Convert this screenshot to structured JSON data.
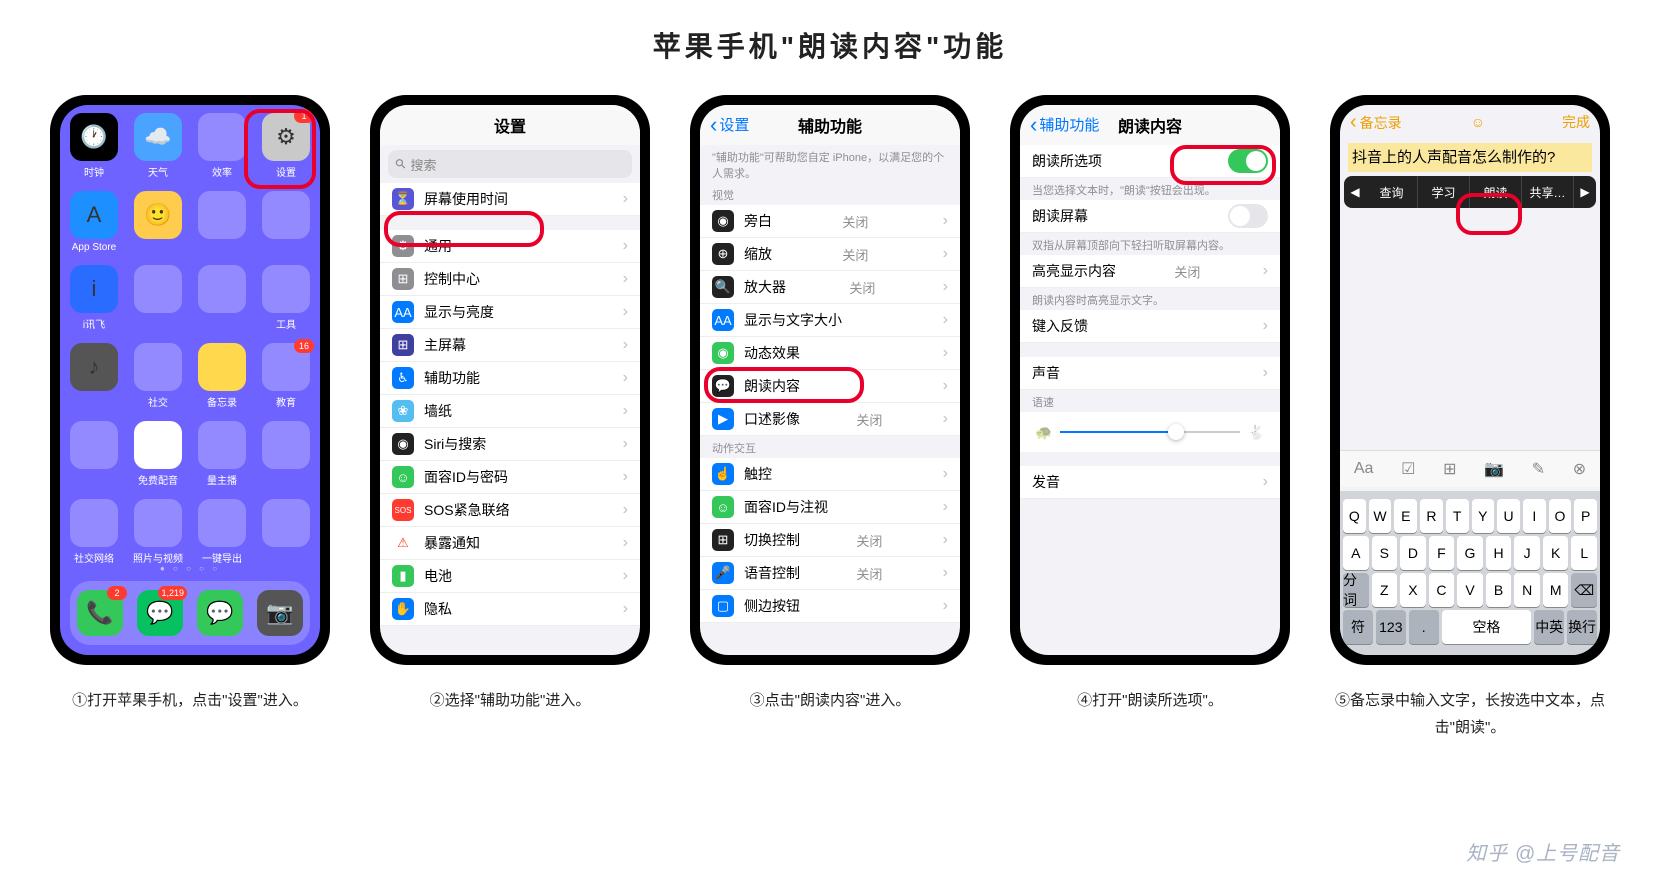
{
  "title": "苹果手机\"朗读内容\"功能",
  "watermark": "知乎 @上号配音",
  "steps": [
    {
      "caption": "①打开苹果手机，点击\"设置\"进入。"
    },
    {
      "caption": "②选择\"辅助功能\"进入。"
    },
    {
      "caption": "③点击\"朗读内容\"进入。"
    },
    {
      "caption": "④打开\"朗读所选项\"。"
    },
    {
      "caption": "⑤备忘录中输入文字，长按选中文本，点击\"朗读\"。"
    }
  ],
  "p1": {
    "apps": [
      {
        "lbl": "时钟",
        "g": "🕐",
        "bg": "#000"
      },
      {
        "lbl": "天气",
        "g": "☁️",
        "bg": "#4aa3ff"
      },
      {
        "lbl": "效率",
        "g": "",
        "bg": ""
      },
      {
        "lbl": "设置",
        "g": "⚙︎",
        "bg": "#c9c9c9",
        "badge": "1"
      },
      {
        "lbl": "App Store",
        "g": "A",
        "bg": "#1e8fff"
      },
      {
        "lbl": "",
        "g": "🙂",
        "bg": "#ffcc4d"
      },
      {
        "lbl": "",
        "g": "",
        "bg": ""
      },
      {
        "lbl": "",
        "g": "",
        "bg": ""
      },
      {
        "lbl": "i讯飞",
        "g": "i",
        "bg": "#2a6cff"
      },
      {
        "lbl": "",
        "g": "",
        "bg": ""
      },
      {
        "lbl": "",
        "g": "",
        "bg": ""
      },
      {
        "lbl": "工具",
        "g": "",
        "bg": ""
      },
      {
        "lbl": "",
        "g": "♪",
        "bg": "#555"
      },
      {
        "lbl": "社交",
        "g": "",
        "bg": ""
      },
      {
        "lbl": "备忘录",
        "g": "",
        "bg": "#ffd84d"
      },
      {
        "lbl": "教育",
        "g": "",
        "bg": "",
        "badge": "16"
      },
      {
        "lbl": "",
        "g": "",
        "bg": ""
      },
      {
        "lbl": "免费配音",
        "g": "",
        "bg": "#fff"
      },
      {
        "lbl": "量主播",
        "g": "",
        "bg": ""
      },
      {
        "lbl": "",
        "g": "",
        "bg": ""
      },
      {
        "lbl": "社交网络",
        "g": "",
        "bg": ""
      },
      {
        "lbl": "照片与视频",
        "g": "",
        "bg": ""
      },
      {
        "lbl": "一键导出",
        "g": "",
        "bg": ""
      },
      {
        "lbl": "",
        "g": "",
        "bg": ""
      }
    ],
    "dock": [
      {
        "g": "📞",
        "bg": "#34c759",
        "badge": "2"
      },
      {
        "g": "💬",
        "bg": "#07c160",
        "badge": "1,219"
      },
      {
        "g": "💬",
        "bg": "#34c759"
      },
      {
        "g": "📷",
        "bg": "#555"
      }
    ]
  },
  "p2": {
    "title": "设置",
    "search": "搜索",
    "items": [
      {
        "t": "屏幕使用时间",
        "c": "#5856d6",
        "g": "⏳"
      },
      {
        "gap": true
      },
      {
        "t": "通用",
        "c": "#8e8e93",
        "g": "⚙︎"
      },
      {
        "t": "控制中心",
        "c": "#8e8e93",
        "g": "⊞"
      },
      {
        "t": "显示与亮度",
        "c": "#007aff",
        "g": "AA"
      },
      {
        "t": "主屏幕",
        "c": "#4040a0",
        "g": "⊞"
      },
      {
        "t": "辅助功能",
        "c": "#007aff",
        "g": "♿︎"
      },
      {
        "t": "墙纸",
        "c": "#55bef0",
        "g": "❀"
      },
      {
        "t": "Siri与搜索",
        "c": "#222",
        "g": "◉"
      },
      {
        "t": "面容ID与密码",
        "c": "#34c759",
        "g": "☺"
      },
      {
        "t": "SOS紧急联络",
        "c": "#ff3b30",
        "g": "SOS",
        "fs": "8px"
      },
      {
        "t": "暴露通知",
        "c": "#fff",
        "g": "⚠︎",
        "fg": "#ff3b30"
      },
      {
        "t": "电池",
        "c": "#34c759",
        "g": "▮"
      },
      {
        "t": "隐私",
        "c": "#007aff",
        "g": "✋"
      }
    ]
  },
  "p3": {
    "back": "设置",
    "title": "辅助功能",
    "hint": "\"辅助功能\"可帮助您自定 iPhone，以满足您的个人需求。",
    "sec1": "视觉",
    "items1": [
      {
        "t": "旁白",
        "v": "关闭",
        "c": "#222",
        "g": "◉"
      },
      {
        "t": "缩放",
        "v": "关闭",
        "c": "#222",
        "g": "⊕"
      },
      {
        "t": "放大器",
        "v": "关闭",
        "c": "#222",
        "g": "🔍"
      },
      {
        "t": "显示与文字大小",
        "c": "#007aff",
        "g": "AA"
      },
      {
        "t": "动态效果",
        "c": "#34c759",
        "g": "◉"
      },
      {
        "t": "朗读内容",
        "c": "#222",
        "g": "💬"
      },
      {
        "t": "口述影像",
        "v": "关闭",
        "c": "#007aff",
        "g": "▶"
      }
    ],
    "sec2": "动作交互",
    "items2": [
      {
        "t": "触控",
        "c": "#007aff",
        "g": "☝"
      },
      {
        "t": "面容ID与注视",
        "c": "#34c759",
        "g": "☺"
      },
      {
        "t": "切换控制",
        "v": "关闭",
        "c": "#222",
        "g": "⊞"
      },
      {
        "t": "语音控制",
        "v": "关闭",
        "c": "#007aff",
        "g": "🎤"
      },
      {
        "t": "侧边按钮",
        "c": "#007aff",
        "g": "▢"
      }
    ]
  },
  "p4": {
    "back": "辅助功能",
    "title": "朗读内容",
    "r1": {
      "t": "朗读所选项",
      "on": true
    },
    "n1": "当您选择文本时，\"朗读\"按钮会出现。",
    "r2": {
      "t": "朗读屏幕",
      "on": false
    },
    "n2": "双指从屏幕顶部向下轻扫听取屏幕内容。",
    "r3": {
      "t": "高亮显示内容",
      "v": "关闭"
    },
    "n3": "朗读内容时高亮显示文字。",
    "r4": {
      "t": "键入反馈"
    },
    "r5": {
      "t": "声音"
    },
    "s": "语速",
    "r6": {
      "t": "发音"
    }
  },
  "p5": {
    "back": "备忘录",
    "done": "完成",
    "face": "☺",
    "text": "抖音上的人声配音怎么制作的?",
    "menu": [
      "查询",
      "学习",
      "朗读",
      "共享…"
    ],
    "kb": {
      "r1": [
        "Q",
        "W",
        "E",
        "R",
        "T",
        "Y",
        "U",
        "I",
        "O",
        "P"
      ],
      "r2": [
        "A",
        "S",
        "D",
        "F",
        "G",
        "H",
        "J",
        "K",
        "L"
      ],
      "r3": [
        "分词",
        "Z",
        "X",
        "C",
        "V",
        "B",
        "N",
        "M",
        "⌫"
      ],
      "r4": [
        "符",
        "123",
        ".",
        "空格",
        "中英",
        "换行"
      ]
    }
  }
}
